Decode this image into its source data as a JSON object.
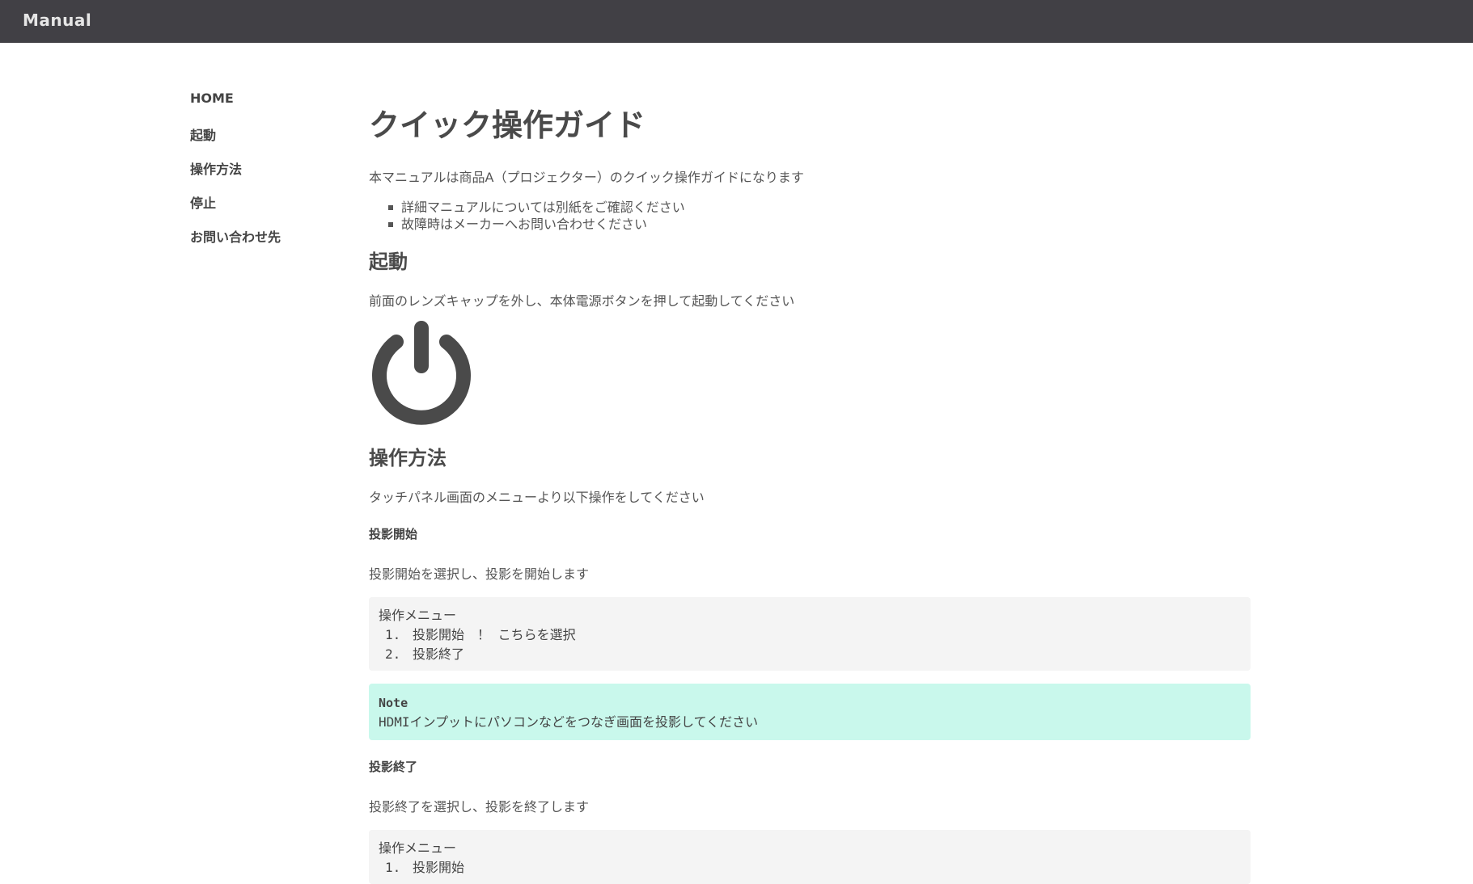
{
  "header": {
    "brand": "Manual"
  },
  "sidebar": {
    "items": [
      {
        "label": "HOME"
      },
      {
        "label": "起動"
      },
      {
        "label": "操作方法"
      },
      {
        "label": "停止"
      },
      {
        "label": "お問い合わせ先"
      }
    ]
  },
  "main": {
    "title": "クイック操作ガイド",
    "intro": "本マニュアルは商品A（プロジェクター）のクイック操作ガイドになります",
    "bullets": [
      "詳細マニュアルについては別紙をご確認ください",
      "故障時はメーカーへお問い合わせください"
    ],
    "start": {
      "heading": "起動",
      "description": "前面のレンズキャップを外し、本体電源ボタンを押して起動してください",
      "icon": "power-icon"
    },
    "operation": {
      "heading": "操作方法",
      "description": "タッチパネル画面のメニューより以下操作をしてください",
      "projection_start": {
        "heading": "投影開始",
        "description": "投影開始を選択し、投影を開始します",
        "menu_title": "操作メニュー",
        "menu_items": [
          {
            "num": "1.",
            "label": "投影開始　！ こちらを選択"
          },
          {
            "num": "2.",
            "label": "投影終了"
          }
        ]
      },
      "note": {
        "title": "Note",
        "text": "HDMIインプットにパソコンなどをつなぎ画面を投影してください"
      },
      "projection_end": {
        "heading": "投影終了",
        "description": "投影終了を選択し、投影を終了します",
        "menu_title": "操作メニュー",
        "menu_items": [
          {
            "num": "1.",
            "label": "投影開始"
          }
        ]
      }
    }
  },
  "colors": {
    "topbar": "#414045",
    "note_bg": "#c9f8ec",
    "code_bg": "#f4f4f4",
    "icon": "#4a4a4a"
  }
}
